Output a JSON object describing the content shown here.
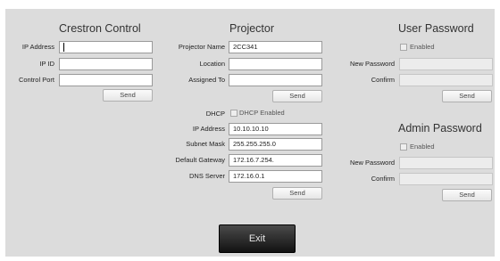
{
  "crestron": {
    "title": "Crestron Control",
    "ip_address_label": "IP Address",
    "ip_id_label": "IP ID",
    "control_port_label": "Control Port",
    "ip_address_value": "",
    "ip_id_value": "",
    "control_port_value": "",
    "send_label": "Send"
  },
  "projector": {
    "title": "Projector",
    "name_label": "Projector Name",
    "name_value": "2CC341",
    "location_label": "Location",
    "location_value": "",
    "assigned_to_label": "Assigned To",
    "assigned_to_value": "",
    "send_label": "Send"
  },
  "network": {
    "dhcp_label": "DHCP",
    "dhcp_checkbox_label": "DHCP Enabled",
    "dhcp_enabled": false,
    "ip_address_label": "IP Address",
    "ip_address_value": "10.10.10.10",
    "subnet_mask_label": "Subnet Mask",
    "subnet_mask_value": "255.255.255.0",
    "default_gateway_label": "Default Gateway",
    "default_gateway_value": "172.16.7.254.",
    "dns_server_label": "DNS Server",
    "dns_server_value": "172.16.0.1",
    "send_label": "Send"
  },
  "user_password": {
    "title": "User Password",
    "enabled_label": "Enabled",
    "enabled": false,
    "new_password_label": "New Password",
    "confirm_label": "Confirm",
    "send_label": "Send"
  },
  "admin_password": {
    "title": "Admin Password",
    "enabled_label": "Enabled",
    "enabled": false,
    "new_password_label": "New Password",
    "confirm_label": "Confirm",
    "send_label": "Send"
  },
  "exit_label": "Exit"
}
